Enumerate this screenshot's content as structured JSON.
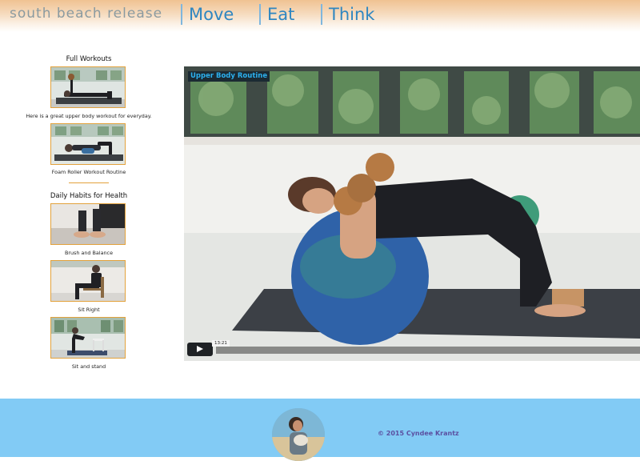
{
  "header": {
    "brand": "south beach release",
    "nav": [
      {
        "label": "Move"
      },
      {
        "label": "Eat"
      },
      {
        "label": "Think"
      }
    ]
  },
  "sidebar": {
    "sections": [
      {
        "title": "Full Workouts",
        "items": [
          {
            "caption": "Here is a great upper body workout for everyday.",
            "thumb_icon": "dumbbell-press-photo"
          },
          {
            "caption": "Foam Roller Workout Routine",
            "thumb_icon": "foam-roller-photo"
          }
        ]
      },
      {
        "title": "Daily Habits for Health",
        "items": [
          {
            "caption": "Brush and Balance",
            "thumb_icon": "feet-balance-photo"
          },
          {
            "caption": "Sit Right",
            "thumb_icon": "seated-posture-photo"
          },
          {
            "caption": "Sit and stand",
            "thumb_icon": "sit-stand-photo"
          }
        ]
      }
    ]
  },
  "video": {
    "title": "Upper Body Routine",
    "duration": "13:21",
    "progress": 0
  },
  "footer": {
    "copyright": "© 2015 Cyndee Krantz"
  },
  "colors": {
    "nav_text": "#2e86c1",
    "brand_text": "#8a9aa0",
    "thumb_border": "#e3a23c",
    "footer_bg": "#82cbf5",
    "copyright_text": "#5b4fa0",
    "video_title_text": "#2cb0ee"
  }
}
